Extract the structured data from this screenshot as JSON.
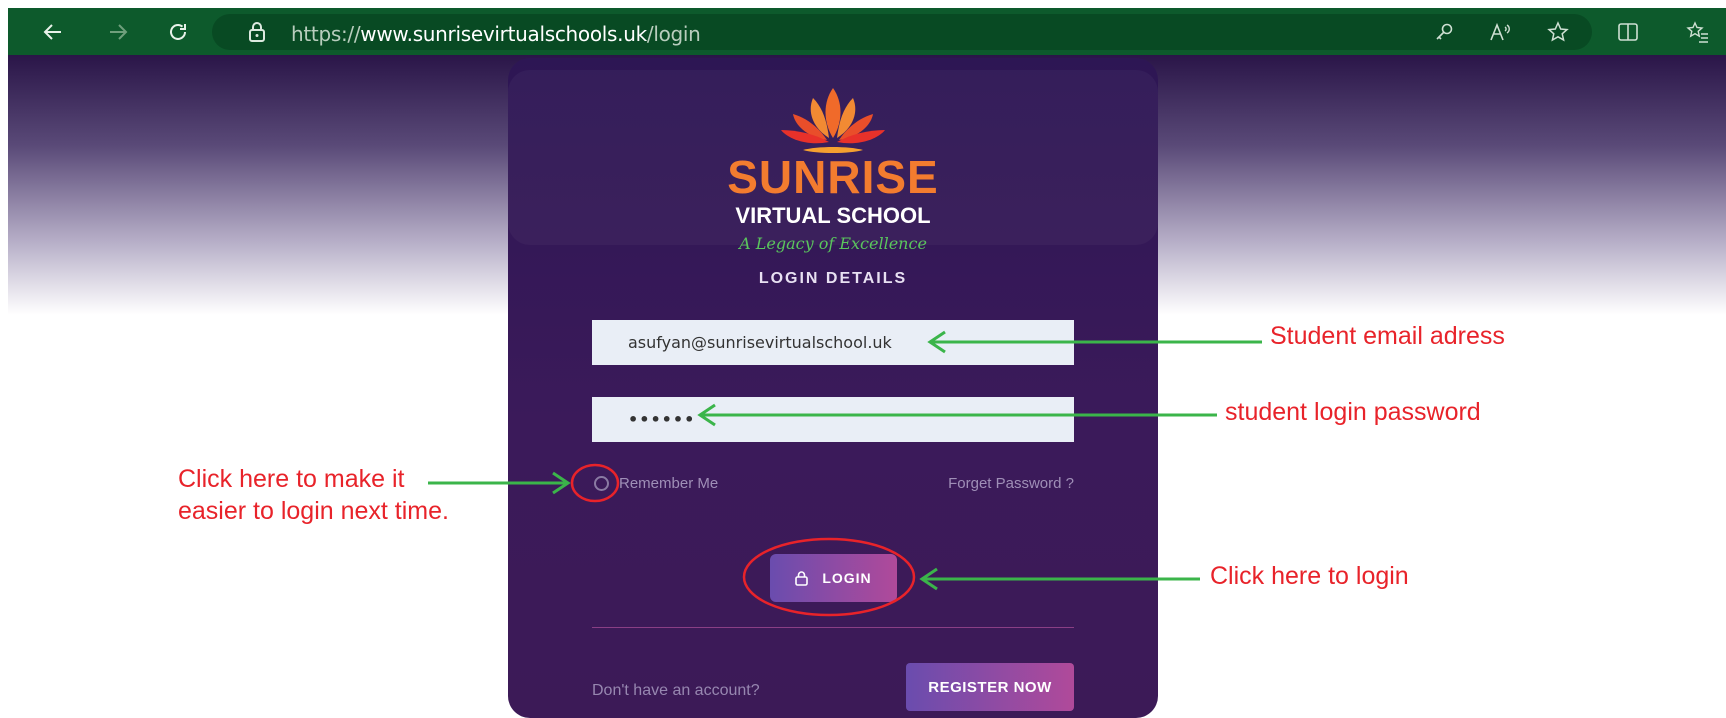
{
  "browser": {
    "url_prefix": "https://",
    "url_domain": "www.sunrisevirtualschools.uk",
    "url_path": "/login",
    "icons": [
      "back-icon",
      "forward-icon",
      "refresh-icon",
      "lock-icon",
      "key-icon",
      "read-aloud-icon",
      "favorite-icon",
      "split-screen-icon",
      "favorites-list-icon"
    ]
  },
  "logo": {
    "line1": "SUNRISE",
    "line2": "VIRTUAL SCHOOL",
    "tagline": "A Legacy of Excellence"
  },
  "form": {
    "title": "LOGIN DETAILS",
    "email_value": "asufyan@sunrisevirtualschool.uk",
    "password_value": "••••••",
    "remember_label": "Remember Me",
    "forgot_label": "Forget Password ?",
    "login_label": "LOGIN",
    "no_account_text": "Don't have an account?",
    "register_label": "REGISTER NOW"
  },
  "annotations": {
    "email": "Student email adress",
    "password": "student login password",
    "remember_line1": "Click here to make it",
    "remember_line2": "easier to login next time.",
    "login": "Click here to login"
  },
  "colors": {
    "browser_bar": "#0d5a2c",
    "card": "#3b1a5a",
    "annotation_text": "#e8232a",
    "annotation_arrow": "#3bb54a",
    "logo_orange": "#f37c2f",
    "tagline_green": "#5ac55d"
  }
}
